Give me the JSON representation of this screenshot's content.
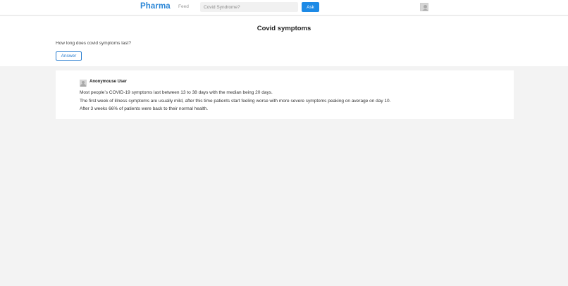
{
  "header": {
    "brand": "Pharma",
    "nav_feed": "Feed",
    "search": {
      "placeholder": "Covid Syndrome?",
      "value": ""
    },
    "ask_label": "Ask"
  },
  "question": {
    "title": "Covid symptoms",
    "text": "How long does covid symptoms last?",
    "answer_label": "Answer"
  },
  "answers": [
    {
      "author": "Anonymouse User",
      "lines": [
        "Most people’s COVID-19 symptoms last between 13 to 38 days with the median being 20 days.",
        "The first week of illness symptoms are usually mild, after this time patients start feeling worse with more severe symptoms peaking on average on day 10.",
        "After 3 weeks 66% of patients were back to their normal health."
      ]
    }
  ],
  "colors": {
    "brand": "#2b86d6",
    "ask_button": "#1d8ae6",
    "answer_outline": "#2b7fd0",
    "page_background": "#f3f3f3"
  }
}
